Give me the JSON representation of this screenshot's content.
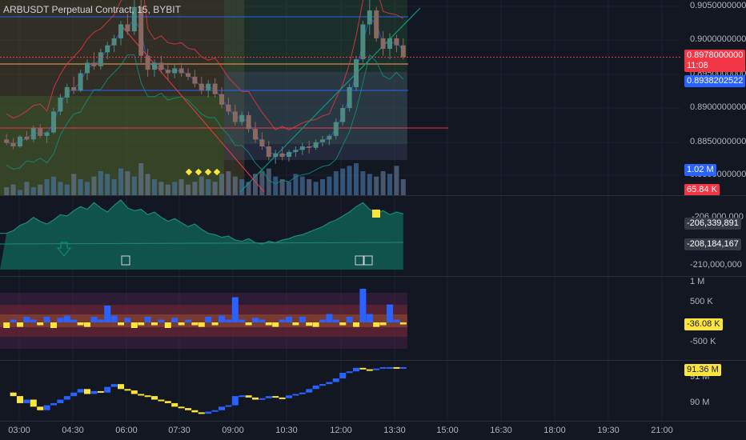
{
  "header": {
    "symbol": "ARBUSDT Perpetual Contract",
    "interval": "15",
    "exchange": "BYBIT"
  },
  "colors": {
    "bg": "#131722",
    "up": "#089981",
    "down": "#f23645",
    "blue": "#2962ff",
    "yellow": "#fbe43b",
    "grid": "#1e222d",
    "teal": "#0f5a50"
  },
  "price_pane": {
    "axis_ticks": [
      "0.9050000000",
      "0.9000000000",
      "0.8950000000",
      "0.8900000000",
      "0.8850000000",
      "0.8800000000"
    ],
    "last_price_tag": "0.8978000000",
    "countdown": "11:08",
    "level_tag": "0.8938202522",
    "volume_tag": "1.02 M",
    "volume_tag2": "65.84 K"
  },
  "pane2": {
    "axis_ticks": [
      "-206,000,000",
      "-210,000,000"
    ],
    "tag1": "-206,339,891",
    "tag2": "-208,184,167"
  },
  "pane3": {
    "axis_ticks": [
      "1 M",
      "500 K",
      "-500 K"
    ],
    "tag": "-36.08 K"
  },
  "pane4": {
    "axis_ticks": [
      "91 M",
      "90 M"
    ],
    "tag": "91.36 M"
  },
  "time_axis": [
    "03:00",
    "04:30",
    "06:00",
    "07:30",
    "09:00",
    "10:30",
    "12:00",
    "13:30",
    "15:00",
    "16:30",
    "18:00",
    "19:30",
    "21:00"
  ],
  "chart_data": {
    "type": "candlestick",
    "title": "ARBUSDT Perpetual Contract, 15, BYBIT",
    "ylim": [
      0.878,
      0.906
    ],
    "candles": [
      [
        0.886,
        0.8868,
        0.8852,
        0.8855
      ],
      [
        0.8855,
        0.8862,
        0.8846,
        0.885
      ],
      [
        0.885,
        0.8866,
        0.8848,
        0.8864
      ],
      [
        0.8864,
        0.8872,
        0.8858,
        0.886
      ],
      [
        0.886,
        0.888,
        0.8856,
        0.8876
      ],
      [
        0.8876,
        0.8882,
        0.8862,
        0.8865
      ],
      [
        0.8865,
        0.8872,
        0.8855,
        0.887
      ],
      [
        0.887,
        0.8905,
        0.8868,
        0.89
      ],
      [
        0.89,
        0.8925,
        0.8895,
        0.892
      ],
      [
        0.892,
        0.894,
        0.8912,
        0.8935
      ],
      [
        0.8935,
        0.895,
        0.8925,
        0.893
      ],
      [
        0.893,
        0.896,
        0.8928,
        0.8955
      ],
      [
        0.8955,
        0.8975,
        0.8945,
        0.897
      ],
      [
        0.897,
        0.8985,
        0.896,
        0.8965
      ],
      [
        0.8965,
        0.899,
        0.896,
        0.8985
      ],
      [
        0.8985,
        0.9,
        0.8975,
        0.8995
      ],
      [
        0.8995,
        0.901,
        0.8985,
        0.9005
      ],
      [
        0.9005,
        0.903,
        0.8995,
        0.9025
      ],
      [
        0.9025,
        0.904,
        0.901,
        0.9015
      ],
      [
        0.9015,
        0.906,
        0.901,
        0.905
      ],
      [
        0.905,
        0.907,
        0.897,
        0.898
      ],
      [
        0.898,
        0.899,
        0.895,
        0.896
      ],
      [
        0.896,
        0.8975,
        0.895,
        0.897
      ],
      [
        0.897,
        0.898,
        0.8955,
        0.896
      ],
      [
        0.896,
        0.897,
        0.8945,
        0.8955
      ],
      [
        0.8955,
        0.8968,
        0.8948,
        0.8962
      ],
      [
        0.8962,
        0.897,
        0.895,
        0.8955
      ],
      [
        0.8955,
        0.8962,
        0.8945,
        0.895
      ],
      [
        0.895,
        0.896,
        0.8935,
        0.894
      ],
      [
        0.894,
        0.895,
        0.8925,
        0.893
      ],
      [
        0.893,
        0.8945,
        0.892,
        0.894
      ],
      [
        0.894,
        0.8948,
        0.892,
        0.8925
      ],
      [
        0.8925,
        0.8935,
        0.8905,
        0.891
      ],
      [
        0.891,
        0.892,
        0.8895,
        0.89
      ],
      [
        0.89,
        0.891,
        0.888,
        0.8885
      ],
      [
        0.8885,
        0.89,
        0.888,
        0.8895
      ],
      [
        0.8895,
        0.89,
        0.887,
        0.8875
      ],
      [
        0.8875,
        0.8885,
        0.8855,
        0.886
      ],
      [
        0.886,
        0.887,
        0.8845,
        0.885
      ],
      [
        0.885,
        0.8858,
        0.883,
        0.8835
      ],
      [
        0.8835,
        0.8845,
        0.8825,
        0.884
      ],
      [
        0.884,
        0.885,
        0.883,
        0.8835
      ],
      [
        0.8835,
        0.8845,
        0.8828,
        0.8842
      ],
      [
        0.8842,
        0.885,
        0.8835,
        0.8845
      ],
      [
        0.8845,
        0.8855,
        0.8838,
        0.885
      ],
      [
        0.885,
        0.8858,
        0.884,
        0.8848
      ],
      [
        0.8848,
        0.886,
        0.8845,
        0.8856
      ],
      [
        0.8856,
        0.8865,
        0.885,
        0.886
      ],
      [
        0.886,
        0.8868,
        0.8852,
        0.8865
      ],
      [
        0.8865,
        0.889,
        0.886,
        0.8885
      ],
      [
        0.8885,
        0.891,
        0.888,
        0.8905
      ],
      [
        0.8905,
        0.894,
        0.89,
        0.8935
      ],
      [
        0.8935,
        0.898,
        0.893,
        0.8975
      ],
      [
        0.8975,
        0.903,
        0.897,
        0.9025
      ],
      [
        0.9025,
        0.906,
        0.901,
        0.9045
      ],
      [
        0.9045,
        0.905,
        0.9,
        0.9005
      ],
      [
        0.9005,
        0.9015,
        0.898,
        0.899
      ],
      [
        0.899,
        0.9012,
        0.8975,
        0.9005
      ],
      [
        0.9005,
        0.901,
        0.8985,
        0.8995
      ],
      [
        0.8995,
        0.9005,
        0.8975,
        0.8978
      ]
    ],
    "volumes": [
      3,
      4,
      2,
      5,
      3,
      4,
      6,
      7,
      5,
      4,
      8,
      6,
      5,
      7,
      9,
      8,
      6,
      10,
      9,
      7,
      12,
      8,
      6,
      5,
      4,
      5,
      6,
      4,
      5,
      7,
      6,
      5,
      8,
      9,
      7,
      6,
      5,
      8,
      9,
      10,
      7,
      6,
      5,
      8,
      7,
      6,
      5,
      6,
      7,
      9,
      10,
      11,
      12,
      9,
      8,
      7,
      9,
      8,
      11,
      6
    ],
    "cvd": [
      -207.8,
      -207.6,
      -207.2,
      -207.0,
      -206.6,
      -206.9,
      -207.1,
      -206.8,
      -206.4,
      -206.5,
      -206.1,
      -205.8,
      -206.0,
      -205.5,
      -205.9,
      -206.2,
      -205.7,
      -205.3,
      -205.9,
      -206.1,
      -206.0,
      -206.4,
      -206.2,
      -206.6,
      -206.9,
      -206.7,
      -207.0,
      -207.3,
      -207.1,
      -207.5,
      -207.8,
      -207.9,
      -208.1,
      -208.0,
      -208.3,
      -208.4,
      -208.2,
      -208.5,
      -208.6,
      -208.4,
      -208.5,
      -208.3,
      -208.2,
      -208.0,
      -207.9,
      -207.7,
      -207.5,
      -207.3,
      -207.0,
      -206.8,
      -206.5,
      -206.2,
      -205.8,
      -205.5,
      -206.0,
      -206.3,
      -206.1,
      -206.4,
      -206.2,
      -206.34
    ],
    "delta": [
      -0.1,
      0.05,
      -0.08,
      0.1,
      0.05,
      -0.05,
      0.1,
      -0.1,
      0.08,
      0.12,
      0.05,
      -0.05,
      -0.08,
      0.1,
      0.05,
      0.3,
      0.12,
      -0.05,
      0.08,
      -0.1,
      -0.05,
      0.1,
      -0.05,
      0.05,
      -0.1,
      0.08,
      -0.05,
      0.05,
      -0.05,
      -0.08,
      0.1,
      -0.05,
      0.12,
      0.05,
      0.45,
      0.05,
      -0.05,
      0.08,
      0.05,
      -0.05,
      -0.08,
      0.05,
      0.1,
      -0.05,
      0.1,
      -0.06,
      -0.08,
      0.05,
      0.15,
      0.05,
      -0.05,
      0.1,
      -0.08,
      0.6,
      0.15,
      -0.08,
      -0.05,
      0.32,
      0.05,
      -0.036
    ],
    "obv": [
      91.0,
      90.95,
      90.85,
      90.9,
      90.8,
      90.75,
      90.82,
      90.85,
      90.9,
      90.95,
      91.0,
      91.05,
      90.98,
      91.02,
      91.0,
      91.08,
      91.12,
      91.05,
      91.03,
      90.98,
      90.96,
      90.95,
      90.9,
      90.88,
      90.85,
      90.8,
      90.78,
      90.75,
      90.72,
      90.7,
      90.73,
      90.75,
      90.8,
      90.82,
      90.95,
      90.96,
      90.93,
      90.9,
      90.92,
      90.95,
      90.93,
      90.92,
      90.96,
      90.98,
      91.0,
      91.05,
      91.1,
      91.12,
      91.15,
      91.2,
      91.28,
      91.3,
      91.35,
      91.33,
      91.32,
      91.34,
      91.36,
      91.36,
      91.35,
      91.36
    ]
  }
}
